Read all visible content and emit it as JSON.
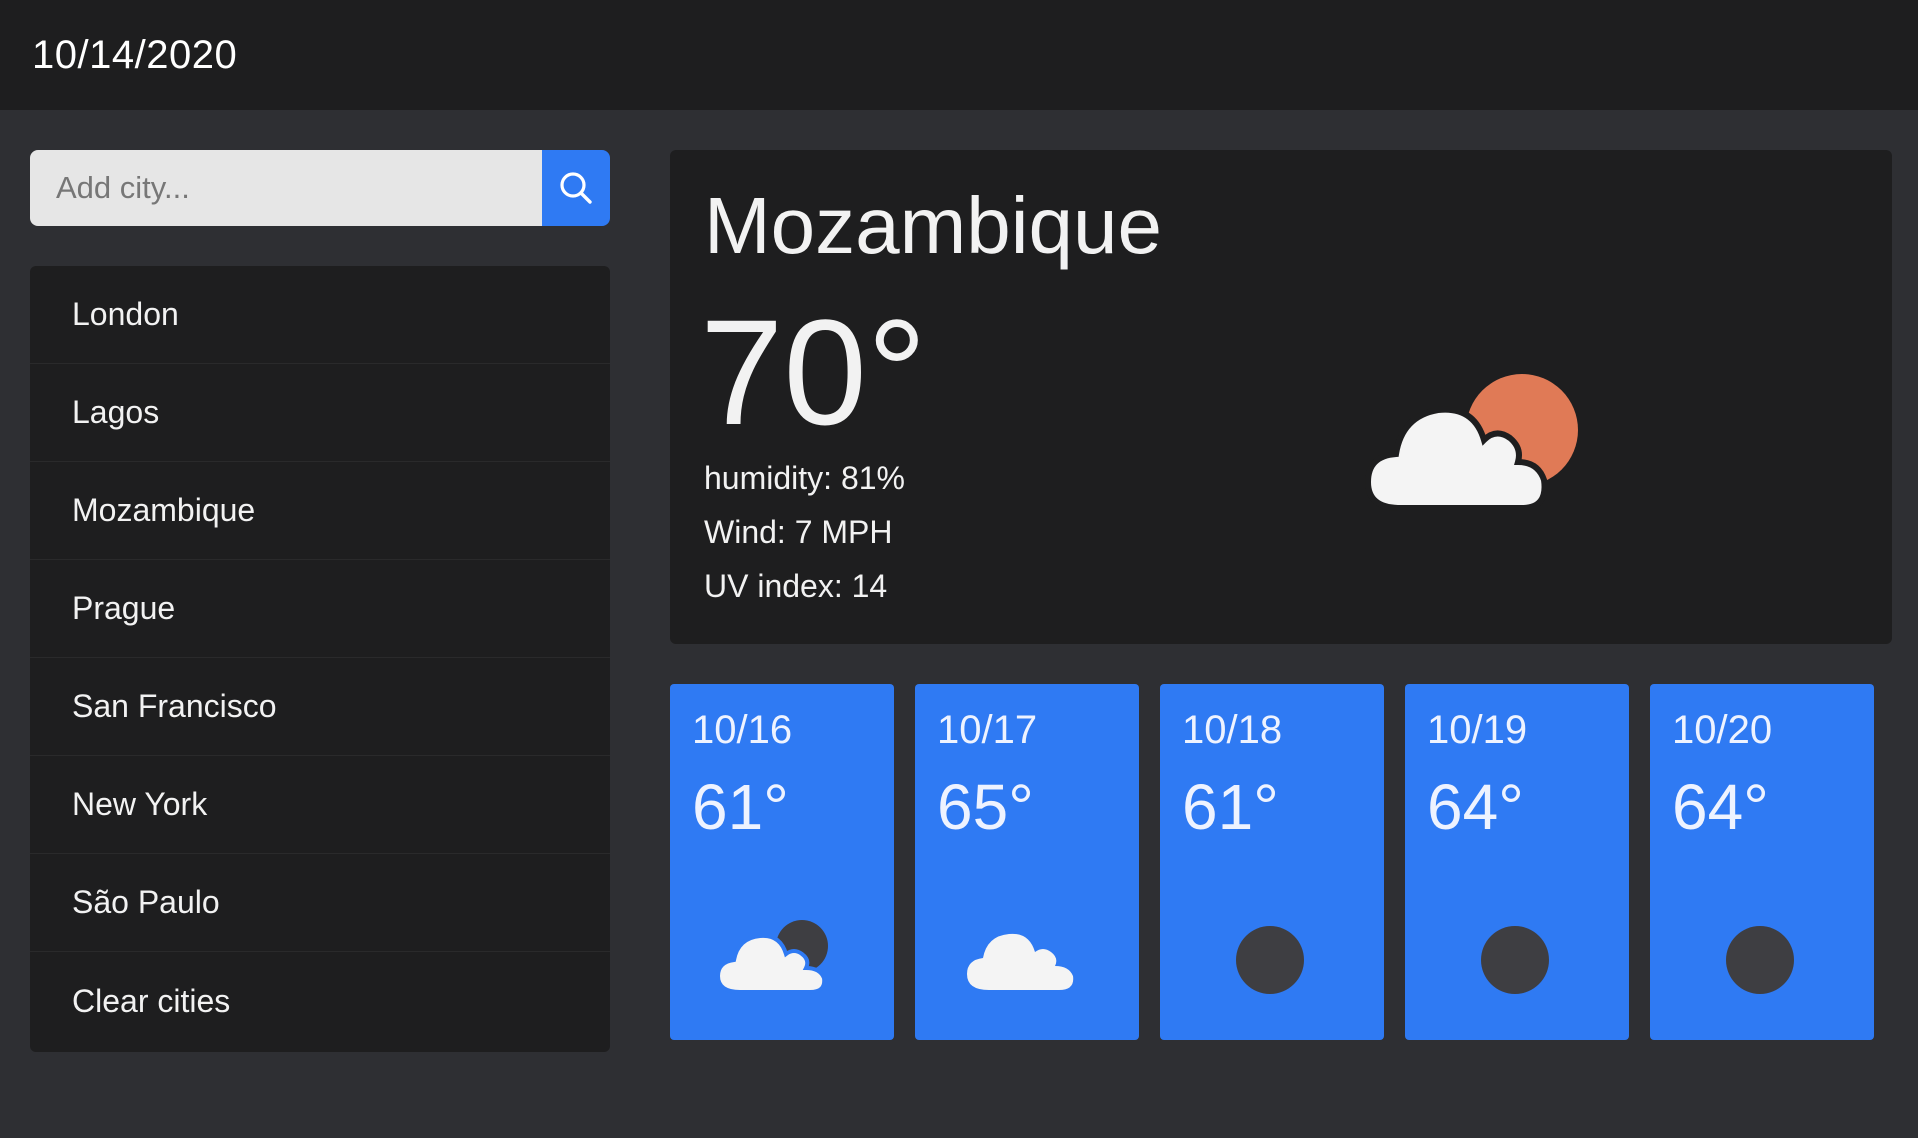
{
  "header": {
    "date": "10/14/2020"
  },
  "search": {
    "placeholder": "Add city...",
    "icon": "search-icon"
  },
  "cities": [
    {
      "label": "London"
    },
    {
      "label": "Lagos"
    },
    {
      "label": "Mozambique"
    },
    {
      "label": "Prague"
    },
    {
      "label": "San Francisco"
    },
    {
      "label": "New York"
    },
    {
      "label": "São Paulo"
    },
    {
      "label": "Clear cities"
    }
  ],
  "current": {
    "city": "Mozambique",
    "temperature": "70°",
    "humidity": "humidity: 81%",
    "wind": "Wind: 7 MPH",
    "uv": "UV index: 14",
    "icon": "partly-cloudy-sun-icon"
  },
  "forecast": [
    {
      "date": "10/16",
      "temp": "61°",
      "icon": "partly-cloudy-night-icon"
    },
    {
      "date": "10/17",
      "temp": "65°",
      "icon": "cloud-icon"
    },
    {
      "date": "10/18",
      "temp": "61°",
      "icon": "moon-icon"
    },
    {
      "date": "10/19",
      "temp": "64°",
      "icon": "moon-icon"
    },
    {
      "date": "10/20",
      "temp": "64°",
      "icon": "moon-icon"
    }
  ],
  "colors": {
    "accent": "#2f7af3",
    "panel": "#1e1e1f",
    "background": "#2e2f33",
    "sun": "#e07a56",
    "moon": "#3e3e42",
    "cloud": "#f4f4f4"
  }
}
